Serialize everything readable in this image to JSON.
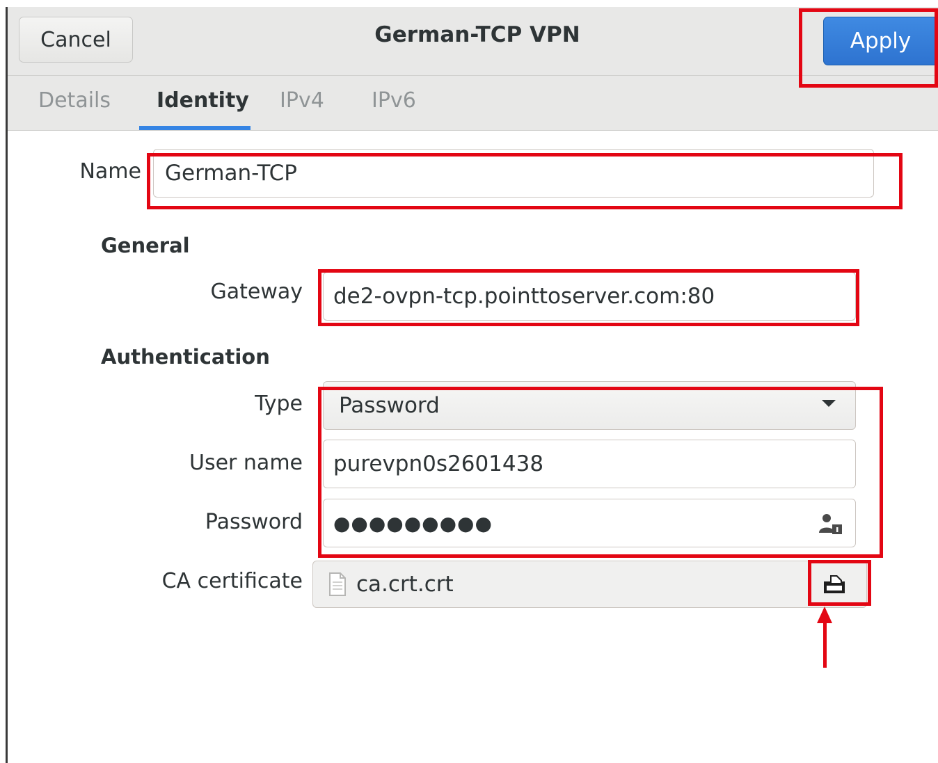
{
  "dialog": {
    "title": "German-TCP VPN",
    "cancel_label": "Cancel",
    "apply_label": "Apply"
  },
  "tabs": [
    {
      "label": "Details",
      "active": false
    },
    {
      "label": "Identity",
      "active": true
    },
    {
      "label": "IPv4",
      "active": false
    },
    {
      "label": "IPv6",
      "active": false
    }
  ],
  "identity": {
    "name_label": "Name",
    "name_value": "German-TCP"
  },
  "general": {
    "section_title": "General",
    "gateway_label": "Gateway",
    "gateway_value": "de2-ovpn-tcp.pointtoserver.com:80"
  },
  "authentication": {
    "section_title": "Authentication",
    "type_label": "Type",
    "type_value": "Password",
    "username_label": "User name",
    "username_value": "purevpn0s2601438",
    "password_label": "Password",
    "password_value": "●●●●●●●●●",
    "ca_label": "CA certificate",
    "ca_value": "ca.crt.crt"
  },
  "icons": {
    "password_store": "user-lock-icon",
    "file": "document-icon",
    "open_file": "folder-open-icon"
  },
  "colors": {
    "accent": "#3584e4",
    "highlight": "#e30613"
  }
}
